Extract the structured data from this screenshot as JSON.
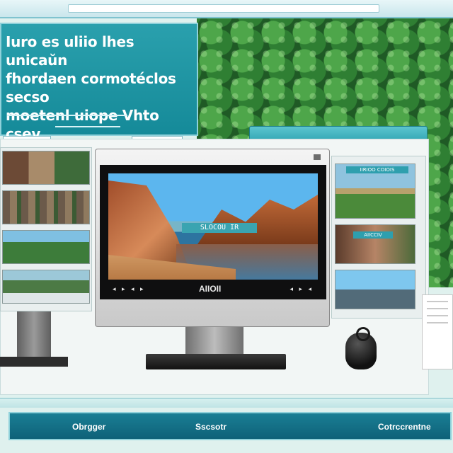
{
  "hero": {
    "headline": "Iuro es uliio lhes unicaŭn\nfhordaen cormotéclos secso\nmoetenl uiope Vhto cşev.",
    "button_left": "",
    "button_right": ""
  },
  "monitor": {
    "overlay_label": "SLOCOU IR",
    "controls_left": "◂ ▸ ◂ ▸",
    "controls_center": "AIIOII",
    "controls_right": "◂ ▸ ◂"
  },
  "right_thumbs": {
    "label_1": "IIRIOO COIOIS",
    "label_2": "AIICCIV"
  },
  "strip": {
    "text": ""
  },
  "nav": {
    "items": [
      "Obrgger",
      "Sscsotr",
      "Cotrccrentne"
    ]
  },
  "colors": {
    "accent": "#158a99",
    "nav_bg": "#0e6178",
    "foliage": "#2f7f33"
  }
}
